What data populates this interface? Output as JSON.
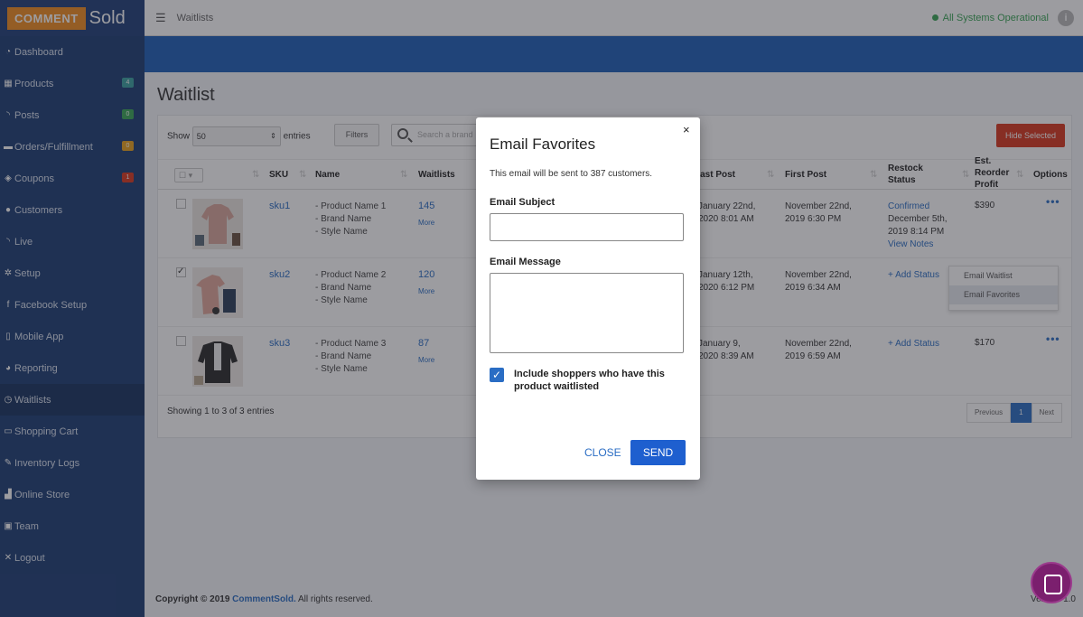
{
  "brand": {
    "logo_comment": "COMMENT",
    "logo_sold": "Sold"
  },
  "topbar": {
    "title": "Waitlists",
    "status": "All Systems Operational",
    "info": "i"
  },
  "sidebar": {
    "items": [
      {
        "label": "Dashboard",
        "icon": "dashboard-icon"
      },
      {
        "label": "Products",
        "icon": "grid-icon",
        "badge": "4",
        "badge_color": "#3aa0a0"
      },
      {
        "label": "Posts",
        "icon": "rss-icon",
        "badge": "0",
        "badge_color": "#3aa656"
      },
      {
        "label": "Orders/Fulfillment",
        "icon": "truck-icon",
        "badge": "0",
        "badge_color": "#e8a11c"
      },
      {
        "label": "Coupons",
        "icon": "tag-icon",
        "badge": "1",
        "badge_color": "#d9381e"
      },
      {
        "label": "Customers",
        "icon": "user-icon"
      },
      {
        "label": "Live",
        "icon": "broadcast-icon"
      },
      {
        "label": "Setup",
        "icon": "gears-icon"
      },
      {
        "label": "Facebook Setup",
        "icon": "facebook-icon"
      },
      {
        "label": "Mobile App",
        "icon": "mobile-icon"
      },
      {
        "label": "Reporting",
        "icon": "chart-icon"
      },
      {
        "label": "Waitlists",
        "icon": "clock-icon",
        "active": true
      },
      {
        "label": "Shopping Cart",
        "icon": "cart-icon"
      },
      {
        "label": "Inventory Logs",
        "icon": "wrench-icon"
      },
      {
        "label": "Online Store",
        "icon": "store-icon"
      },
      {
        "label": "Team",
        "icon": "team-icon"
      },
      {
        "label": "Logout",
        "icon": "close-icon"
      }
    ]
  },
  "page": {
    "title": "Waitlist"
  },
  "table": {
    "show_label": "Show",
    "entries_value": "50",
    "entries_label": "entries",
    "filters_label": "Filters",
    "search_placeholder": "Search a brand",
    "hide_selected": "Hide Selected",
    "columns": [
      "SKU",
      "Name",
      "Waitlists",
      "Last Post",
      "First Post",
      "Restock Status",
      "Est. Reorder Profit",
      "Options"
    ],
    "rows": [
      {
        "sku": "sku1",
        "name": "- Product Name 1\n- Brand Name\n- Style Name",
        "waitlists": "145",
        "more": "More",
        "last_post": "January 22nd,\n2020 8:01 AM",
        "first_post": "November 22nd,\n2019 6:30 PM",
        "restock_status": "Confirmed",
        "restock_date": "December 5th,\n2019 8:14 PM",
        "view_notes": "View Notes",
        "profit": "$390",
        "checked": false
      },
      {
        "sku": "sku2",
        "name": "- Product Name 2\n- Brand Name\n- Style Name",
        "waitlists": "120",
        "more": "More",
        "last_post": "January 12th,\n2020 6:12 PM",
        "first_post": "November 22nd,\n2019 6:34 AM",
        "restock_status": "+ Add Status",
        "profit": "",
        "checked": true
      },
      {
        "sku": "sku3",
        "name": "- Product Name 3\n- Brand Name\n- Style Name",
        "waitlists": "87",
        "more": "More",
        "last_post": "January 9,\n2020 8:39 AM",
        "first_post": "November 22nd,\n2019 6:59 AM",
        "restock_status": "+ Add Status",
        "profit": "$170",
        "checked": false
      }
    ],
    "options_menu": [
      "Email Waitlist",
      "Email Favorites"
    ],
    "footer": "Showing 1 to 3 of 3 entries",
    "pager": {
      "prev": "Previous",
      "page": "1",
      "next": "Next"
    }
  },
  "footer": {
    "copyright": "Copyright © 2019",
    "company": "CommentSold.",
    "rights": "All rights reserved.",
    "version": "Version 1.0"
  },
  "modal": {
    "title": "Email Favorites",
    "close_x": "×",
    "subtitle": "This email will be sent to 387 customers.",
    "subject_label": "Email Subject",
    "subject_value": "",
    "message_label": "Email Message",
    "message_value": "",
    "checkbox_label": "Include shoppers who have this product waitlisted",
    "checkbox_checked": true,
    "close_label": "CLOSE",
    "send_label": "SEND"
  }
}
